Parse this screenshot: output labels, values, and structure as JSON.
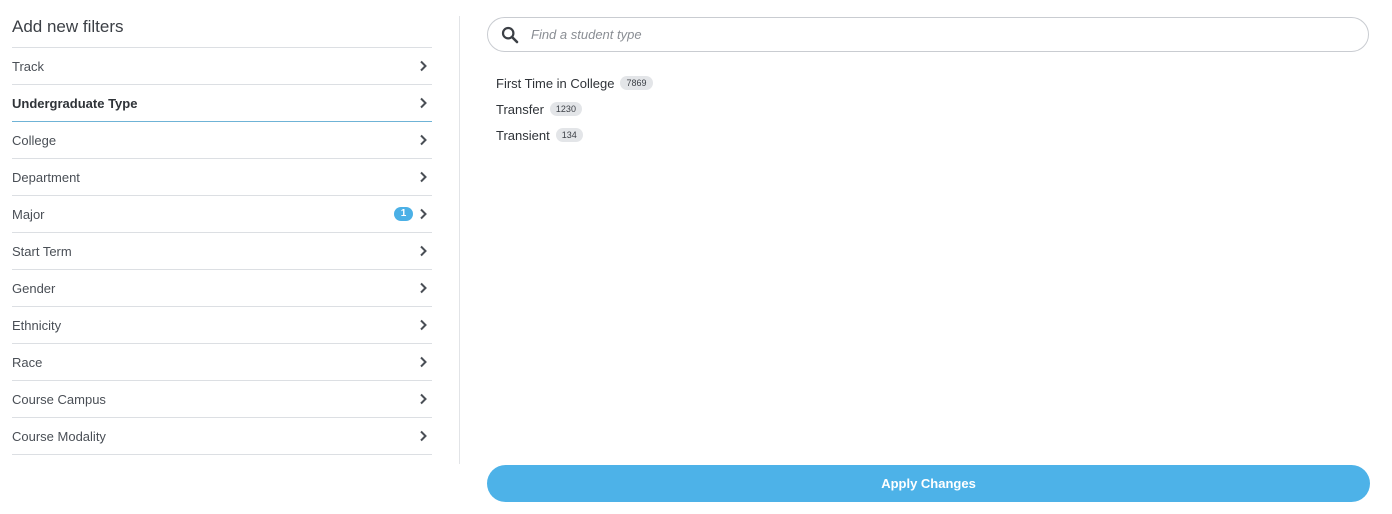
{
  "left_panel": {
    "title": "Add new filters",
    "filters": [
      {
        "label": "Track",
        "badge": null,
        "active": false
      },
      {
        "label": "Undergraduate Type",
        "badge": null,
        "active": true
      },
      {
        "label": "College",
        "badge": null,
        "active": false
      },
      {
        "label": "Department",
        "badge": null,
        "active": false
      },
      {
        "label": "Major",
        "badge": "1",
        "active": false
      },
      {
        "label": "Start Term",
        "badge": null,
        "active": false
      },
      {
        "label": "Gender",
        "badge": null,
        "active": false
      },
      {
        "label": "Ethnicity",
        "badge": null,
        "active": false
      },
      {
        "label": "Race",
        "badge": null,
        "active": false
      },
      {
        "label": "Course Campus",
        "badge": null,
        "active": false
      },
      {
        "label": "Course Modality",
        "badge": null,
        "active": false
      }
    ]
  },
  "search": {
    "placeholder": "Find a student type",
    "value": ""
  },
  "results": [
    {
      "label": "First Time in College",
      "count": "7869"
    },
    {
      "label": "Transfer",
      "count": "1230"
    },
    {
      "label": "Transient",
      "count": "134"
    }
  ],
  "apply_button": {
    "label": "Apply Changes"
  },
  "colors": {
    "accent": "#4db2e8",
    "badge": "#4bb0e6",
    "active_underline": "#6fb3d6"
  },
  "icons": {
    "search": "search-icon",
    "chevron": "chevron-right-icon"
  }
}
